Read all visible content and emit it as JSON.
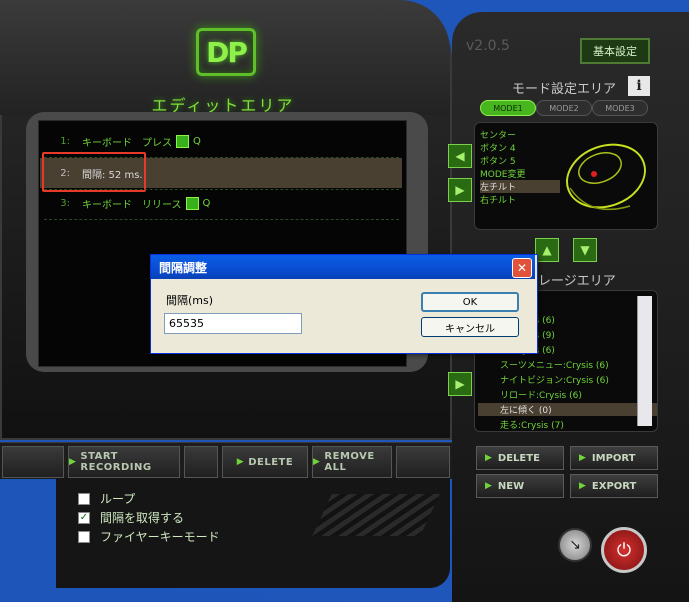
{
  "app": {
    "logo": "DP",
    "version": "v2.0.5",
    "basic_settings": "基本設定"
  },
  "edit_area": {
    "title": "エディットエリア",
    "events": [
      {
        "num": "1:",
        "text": "キーボード　プレス",
        "key": "Q"
      },
      {
        "num": "2:",
        "text": "間隔: 52 ms.",
        "key": ""
      },
      {
        "num": "3:",
        "text": "キーボード　リリース",
        "key": "Q"
      }
    ]
  },
  "bottom_buttons": {
    "start_recording": "START RECORDING",
    "delete": "DELETE",
    "remove_all": "REMOVE ALL"
  },
  "options": {
    "loop": "ループ",
    "get_interval": "間隔を取得する",
    "fire_key_mode": "ファイヤーキーモード",
    "loop_checked": false,
    "get_interval_checked": true,
    "fire_key_mode_checked": false
  },
  "mode_area": {
    "title": "モード設定エリア",
    "info": "i",
    "tabs": [
      "MODE1",
      "MODE2",
      "MODE3"
    ],
    "items": [
      "センター",
      "ボタン 4",
      "ボタン 5",
      "MODE変更",
      "左チルト",
      "右チルト"
    ],
    "selected": "左チルト"
  },
  "macro_area": {
    "title": "レージエリア",
    "items": [
      "ー:Crysis (6)",
      "ー:Crysis (9)",
      "ー:Crysis (6)",
      "スーツメニュー:Crysis (6)",
      "ナイトビジョン:Crysis (6)",
      "リロード:Crysis (6)",
      "左に傾く (0)",
      "走る:Crysis (7)"
    ],
    "selected": "左に傾く (0)"
  },
  "right_buttons": {
    "delete": "DELETE",
    "import": "IMPORT",
    "new": "NEW",
    "export": "EXPORT"
  },
  "dialog": {
    "title": "間隔調整",
    "close": "✕",
    "label": "間隔(ms)",
    "value": "65535",
    "ok": "OK",
    "cancel": "キャンセル"
  }
}
